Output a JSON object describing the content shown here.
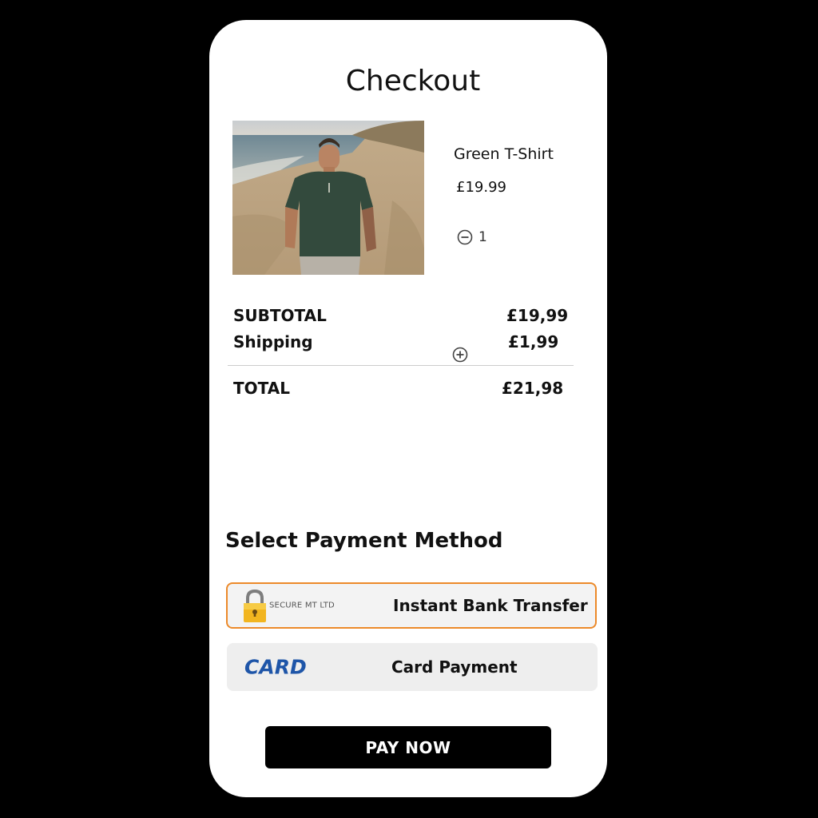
{
  "page": {
    "title": "Checkout"
  },
  "product": {
    "name": "Green T-Shirt",
    "price": "£19.99",
    "quantity": "1",
    "image_icon": "product-photo",
    "decrease_icon": "minus-circle-icon",
    "increase_icon": "plus-circle-icon"
  },
  "summary": {
    "subtotal_label": "SUBTOTAL",
    "subtotal_value": "£19,99",
    "shipping_label": "Shipping",
    "shipping_value": "£1,99",
    "total_label": "TOTAL",
    "total_value": "£21,98"
  },
  "payment": {
    "heading": "Select Payment Method",
    "options": [
      {
        "label": "Instant Bank Transfer",
        "logo_text": "SECURE MT LTD",
        "logo_icon": "padlock-icon",
        "selected": true
      },
      {
        "label": "Card Payment",
        "logo_text": "CARD",
        "selected": false
      }
    ]
  },
  "actions": {
    "pay_label": "PAY NOW"
  },
  "colors": {
    "background": "#000000",
    "card": "#ffffff",
    "selected_border": "#ec8a2a",
    "option_background": "#eeeeee",
    "card_logo": "#1e55a8",
    "button": "#000000",
    "button_text": "#ffffff"
  }
}
